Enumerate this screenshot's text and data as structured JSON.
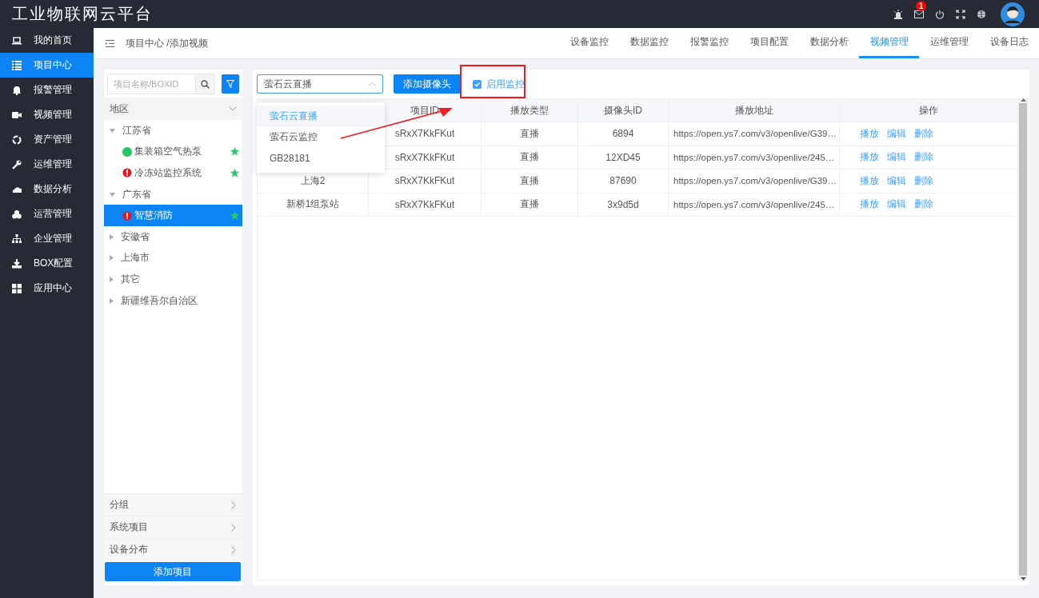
{
  "app": {
    "title": "工业物联网云平台",
    "mail_badge": "1"
  },
  "nav": [
    {
      "label": "我的首页",
      "selected": false
    },
    {
      "label": "项目中心",
      "selected": true
    },
    {
      "label": "报警管理",
      "selected": false
    },
    {
      "label": "视频管理",
      "selected": false
    },
    {
      "label": "资产管理",
      "selected": false
    },
    {
      "label": "运维管理",
      "selected": false
    },
    {
      "label": "数据分析",
      "selected": false
    },
    {
      "label": "运营管理",
      "selected": false
    },
    {
      "label": "企业管理",
      "selected": false
    },
    {
      "label": "BOX配置",
      "selected": false
    },
    {
      "label": "应用中心",
      "selected": false
    }
  ],
  "breadcrumb": "项目中心 /添加视频",
  "tabs": [
    {
      "label": "设备监控",
      "selected": false
    },
    {
      "label": "数据监控",
      "selected": false
    },
    {
      "label": "报警监控",
      "selected": false
    },
    {
      "label": "项目配置",
      "selected": false
    },
    {
      "label": "数据分析",
      "selected": false
    },
    {
      "label": "视频管理",
      "selected": true
    },
    {
      "label": "运维管理",
      "selected": false
    },
    {
      "label": "设备日志",
      "selected": false
    }
  ],
  "tree_panel": {
    "search": {
      "placeholder": "项目名称/BOXID"
    },
    "region_header": "地区",
    "regions": [
      {
        "label": "江苏省",
        "expanded": true,
        "children": [
          {
            "label": "集装箱空气热泵",
            "kind": "ok",
            "starred": true,
            "selected": false
          },
          {
            "label": "冷冻站监控系统",
            "kind": "alarm",
            "starred": true,
            "selected": false
          }
        ]
      },
      {
        "label": "广东省",
        "expanded": true,
        "children": [
          {
            "label": "智慧消防",
            "kind": "alarm",
            "starred": true,
            "selected": true
          }
        ]
      },
      {
        "label": "安徽省",
        "expanded": false
      },
      {
        "label": "上海市",
        "expanded": false
      },
      {
        "label": "其它",
        "expanded": false
      },
      {
        "label": "新疆维吾尔自治区",
        "expanded": false
      }
    ],
    "sections": [
      "分组",
      "系统项目",
      "设备分布"
    ],
    "add_button": "添加项目"
  },
  "video_panel": {
    "source_select": {
      "value": "萤石云直播",
      "open": true,
      "options": [
        {
          "label": "萤石云直播",
          "selected": true
        },
        {
          "label": "萤石云监控",
          "selected": false
        },
        {
          "label": "GB28181",
          "selected": false
        }
      ]
    },
    "add_camera_button": "添加摄像头",
    "enable_monitor": {
      "label": "启用监控",
      "checked": true
    },
    "table": {
      "columns": [
        "项目ID",
        "播放类型",
        "摄像头ID",
        "播放地址",
        "操作"
      ],
      "rows": [
        {
          "project_id": "sRxX7KkFKut",
          "play_type": "直播",
          "camera_id": "6894",
          "play_url": "https://open.ys7.com/v3/openlive/G39…",
          "actions": [
            "播放",
            "编辑",
            "删除"
          ]
        },
        {
          "project_id": "sRxX7KkFKut",
          "play_type": "直播",
          "camera_id": "12XD45",
          "play_url": "https://open.ys7.com/v3/openlive/245…",
          "actions": [
            "播放",
            "编辑",
            "删除"
          ]
        },
        {
          "column_1": "上海2",
          "project_id": "sRxX7KkFKut",
          "play_type": "直播",
          "camera_id": "87690",
          "play_url": "https://open.ys7.com/v3/openlive/G39…",
          "actions": [
            "播放",
            "编辑",
            "删除"
          ]
        },
        {
          "column_1": "新桥1组泵站",
          "project_id": "sRxX7KkFKut",
          "play_type": "直播",
          "camera_id": "3x9d5d",
          "play_url": "https://open.ys7.com/v3/openlive/245…",
          "actions": [
            "播放",
            "编辑",
            "删除"
          ]
        }
      ]
    },
    "highlight_box": true,
    "annotation_arrow": true
  }
}
